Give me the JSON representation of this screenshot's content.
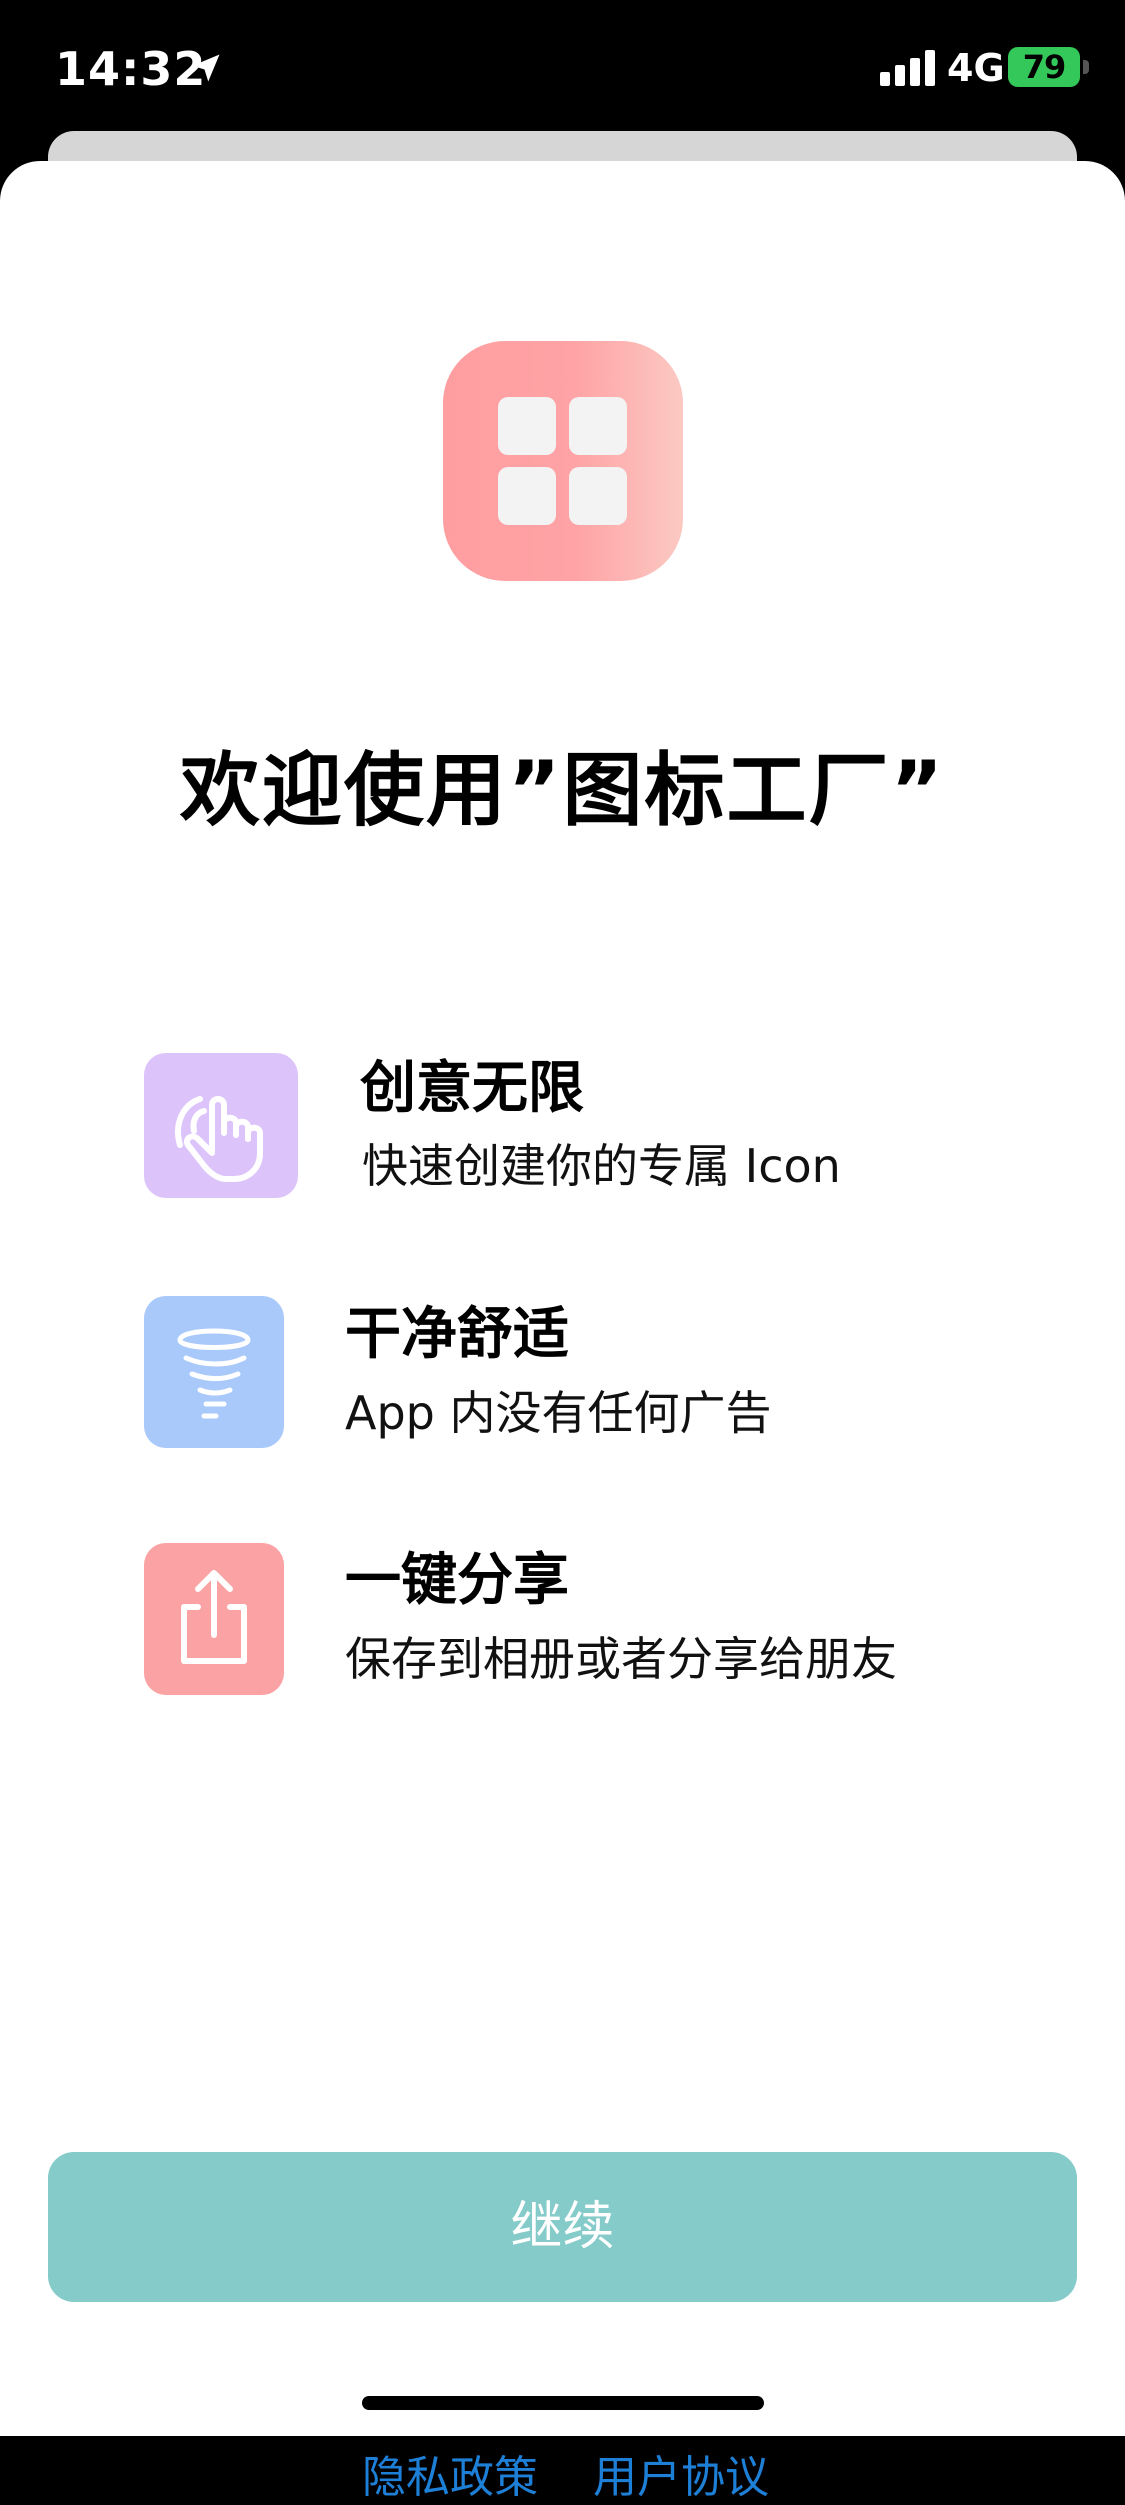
{
  "status_bar": {
    "time": "14:32",
    "network": "4G",
    "battery": "79",
    "icons": [
      "location-arrow-icon",
      "signal-bars-icon",
      "battery-charging-icon"
    ]
  },
  "app_icon": "grid-four-tiles-icon",
  "welcome": {
    "title": "欢迎使用”图标工厂”"
  },
  "features": [
    {
      "icon": "hand-tap-icon",
      "color": "#dcc4fb",
      "title": "创意无限",
      "desc": "快速创建你的专属 Icon"
    },
    {
      "icon": "tornado-icon",
      "color": "#a9c9fb",
      "title": "干净舒适",
      "desc": "App 内没有任何广告"
    },
    {
      "icon": "share-icon",
      "color": "#fba3a4",
      "title": "一键分享",
      "desc": "保存到相册或者分享给朋友"
    }
  ],
  "continue_button": {
    "label": "继续",
    "color": "#85cbc9"
  },
  "footer": {
    "privacy": "隐私政策",
    "terms": "用户协议",
    "link_color": "#1e7fd6"
  }
}
